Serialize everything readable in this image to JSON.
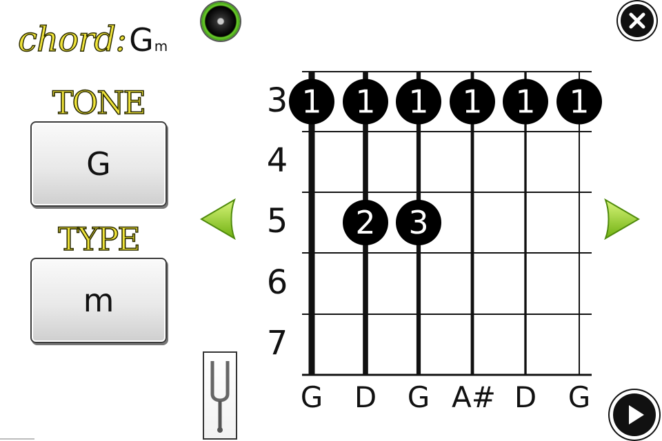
{
  "title": {
    "label": "chord:",
    "tone": "G",
    "type": "m"
  },
  "tone": {
    "label": "TONE",
    "value": "G"
  },
  "type": {
    "label": "TYPE",
    "value": "m"
  },
  "fretboard": {
    "frets": [
      "3",
      "4",
      "5",
      "6",
      "7"
    ],
    "strings": [
      "G",
      "D",
      "G",
      "A#",
      "D",
      "G"
    ],
    "markers": [
      {
        "string": 0,
        "fret": "3",
        "finger": "1"
      },
      {
        "string": 1,
        "fret": "3",
        "finger": "1"
      },
      {
        "string": 2,
        "fret": "3",
        "finger": "1"
      },
      {
        "string": 3,
        "fret": "3",
        "finger": "1"
      },
      {
        "string": 4,
        "fret": "3",
        "finger": "1"
      },
      {
        "string": 5,
        "fret": "3",
        "finger": "1"
      },
      {
        "string": 1,
        "fret": "5",
        "finger": "2"
      },
      {
        "string": 2,
        "fret": "5",
        "finger": "3"
      }
    ]
  },
  "icons": {
    "speaker": "speaker-icon",
    "close": "close-icon",
    "play": "play-icon",
    "prev": "left-arrow-icon",
    "next": "right-arrow-icon",
    "tuner": "tuning-fork-icon"
  },
  "colors": {
    "accent_yellow": "#f0e43a",
    "arrow_green": "#9ddc1e",
    "marker": "#000000"
  }
}
